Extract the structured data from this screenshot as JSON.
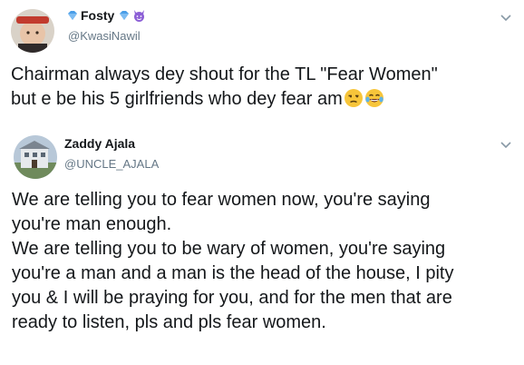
{
  "tweet1": {
    "display_name": "Fosty",
    "handle": "@KwasiNawil",
    "body": "Chairman always dey shout for the TL \"Fear Women\"\nbut e be his 5 girlfriends who dey fear am",
    "emojis": [
      "unamused-face",
      "face-with-tears-of-joy"
    ]
  },
  "tweet2": {
    "display_name": "Zaddy Ajala",
    "handle": "@UNCLE_AJALA",
    "body": "We are telling you to fear women now, you're saying\nyou're man enough.\nWe are telling you to be wary of women, you're saying\nyou're a man and a man is the head of the house, I pity\nyou & I will be praying for you, and for the men that are\nready to listen, pls and pls fear women."
  },
  "colors": {
    "text": "#14171a",
    "secondary": "#657786",
    "verified_blue": "#4a9ee8",
    "devil_purple": "#8c5fd6"
  },
  "icons": [
    "diamond-icon",
    "devil-icon",
    "chevron-down-icon"
  ]
}
